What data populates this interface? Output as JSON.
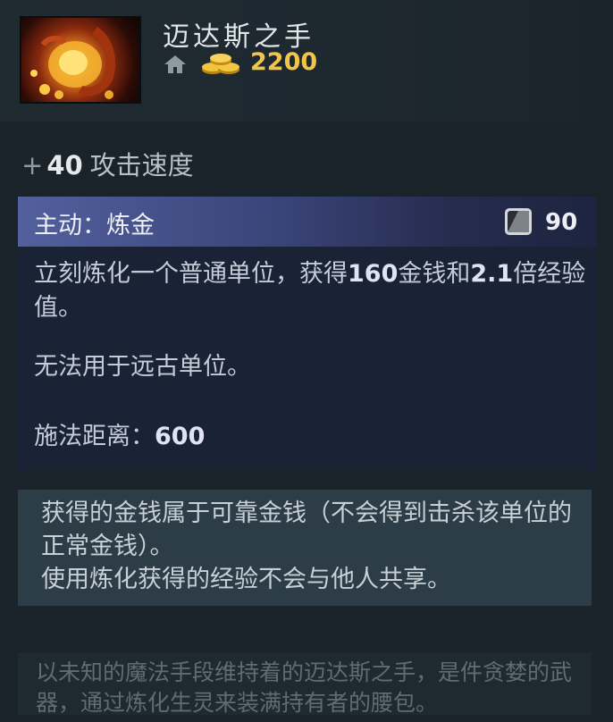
{
  "item": {
    "name": "迈达斯之手",
    "cost": "2200"
  },
  "stat": {
    "plus": "+",
    "value": "40",
    "label": "攻击速度"
  },
  "ability": {
    "title": "主动：炼金",
    "cooldown": "90",
    "desc_part1": "立刻炼化一个普通单位，获得",
    "gold_value": "160",
    "desc_part2": "金钱和",
    "xp_multiplier": "2.1",
    "desc_part3": "倍经验值。",
    "restriction": "无法用于远古单位。",
    "cast_range_label": "施法距离：",
    "cast_range_value": "600"
  },
  "note": {
    "line1": "获得的金钱属于可靠金钱（不会得到击杀该单位的正常金钱）。",
    "line2": "使用炼化获得的经验不会与他人共享。"
  },
  "lore": {
    "text": "以未知的魔法手段维持着的迈达斯之手，是件贪婪的武器，通过炼化生灵来装满持有者的腰包。"
  },
  "icons": {
    "item": "midas-hand-icon",
    "shop": "home-icon",
    "gold": "gold-coins-icon",
    "cooldown": "cooldown-icon"
  },
  "colors": {
    "gold": "#f1c44a",
    "ability_header": "#52609d",
    "background": "#1a2329"
  }
}
